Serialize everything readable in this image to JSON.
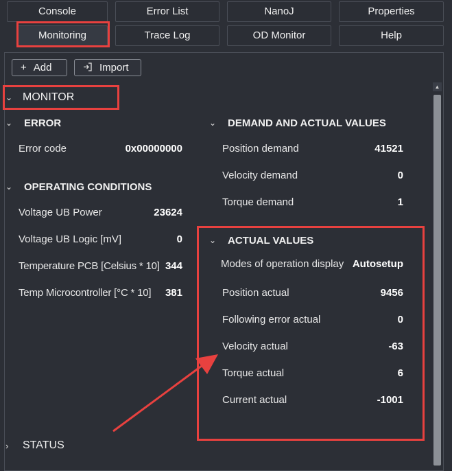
{
  "tabs": [
    {
      "label": "Console"
    },
    {
      "label": "Error List"
    },
    {
      "label": "NanoJ"
    },
    {
      "label": "Properties"
    },
    {
      "label": "Monitoring"
    },
    {
      "label": "Trace Log"
    },
    {
      "label": "OD Monitor"
    },
    {
      "label": "Help"
    }
  ],
  "active_tab": "Monitoring",
  "toolbar": {
    "add_label": "Add",
    "import_label": "Import"
  },
  "monitor": {
    "title": "MONITOR",
    "status_title": "STATUS",
    "error": {
      "title": "ERROR",
      "rows": [
        {
          "label": "Error code",
          "value": "0x00000000"
        }
      ]
    },
    "operating": {
      "title": "OPERATING CONDITIONS",
      "rows": [
        {
          "label": "Voltage UB Power",
          "value": "23624"
        },
        {
          "label": "Voltage UB Logic [mV]",
          "value": "0"
        },
        {
          "label": "Temperature PCB [Celsius * 10]",
          "value": "344"
        },
        {
          "label": "Temp Microcontroller [°C * 10]",
          "value": "381"
        }
      ]
    },
    "demand": {
      "title": "DEMAND AND ACTUAL VALUES",
      "rows": [
        {
          "label": "Position demand",
          "value": "41521"
        },
        {
          "label": "Velocity demand",
          "value": "0"
        },
        {
          "label": "Torque demand",
          "value": "1"
        }
      ]
    },
    "actual": {
      "title": "ACTUAL VALUES",
      "rows": [
        {
          "label": "Modes of operation display",
          "value": "Autosetup"
        },
        {
          "label": "Position actual",
          "value": "9456"
        },
        {
          "label": "Following error actual",
          "value": "0"
        },
        {
          "label": "Velocity actual",
          "value": "-63"
        },
        {
          "label": "Torque actual",
          "value": "6"
        },
        {
          "label": "Current actual",
          "value": "-1001"
        }
      ]
    }
  },
  "colors": {
    "highlight": "#e8413f",
    "active_underline": "#4b63d6",
    "background": "#2c2f36"
  }
}
